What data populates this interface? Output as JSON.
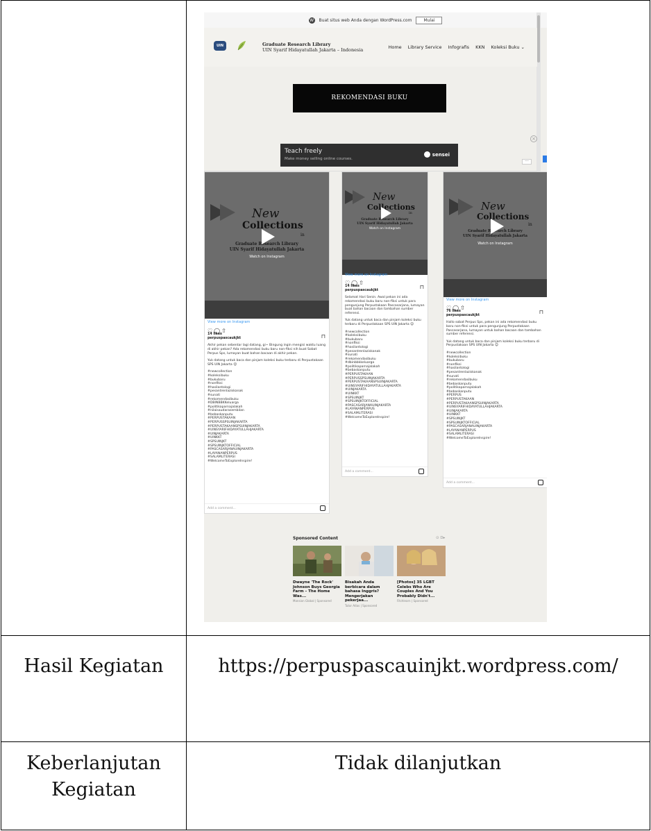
{
  "wp_bar": {
    "text": "Buat situs web Anda dengan WordPress.com",
    "button": "Mulai"
  },
  "site": {
    "logo_text": "UIN",
    "title_line1": "Graduate Research Library",
    "title_line2": "UIN Syarif Hidayatullah Jakarta – Indonesia",
    "nav": [
      "Home",
      "Library Service",
      "Infografis",
      "KKN",
      "Koleksi Buku"
    ],
    "nav_dropdown_glyph": "⌄",
    "heading": "REKOMENDASI BUKU"
  },
  "ad": {
    "title": "Teach freely",
    "subtitle": "Make money selling online courses.",
    "brand": "sensei",
    "close_glyph": "×",
    "menu_glyph": "···"
  },
  "posts": [
    {
      "image_text": {
        "new": "New",
        "collections": "Collections",
        "in": "in",
        "line1": "Graduate Research Library",
        "line2": "UIN Syarif Hidayatullah Jakarta",
        "watch": "Watch on Instagram"
      },
      "view_more": "View more on Instagram",
      "likes": "14 likes",
      "user": "perpuspascaukjkt",
      "caption": "Akhir pekan sebentar lagi datang, gi~ Bingung ingin mengisi waktu luang di akhir pekan? Ada rekomendasi buku baru non-fiksi nih buat Sobat Perpus Sps, lumayan buat bahan bacaan di akhir pekan.",
      "cta": "Yuk datang untuk baca dan pinjam koleksi buku terbaru di Perpustakaan SPS UIN Jakarta 😊",
      "tags": [
        "#newcollection",
        "#koleksibuku",
        "#bukubaru",
        "#nonfiksi",
        "#hasilantologi",
        "#pesantrenlaziskanak",
        "#sunati",
        "#rekomendasibuku",
        "#DBINBBKKeluarga",
        "#politikaparnajalakah",
        "#nilaisaudarasembilan",
        "#bebaskanputu",
        "#PERPUSTAKAAN",
        "#PERPUSSPSUINJAKARTA",
        "#PERPUSTAKAANSPSUINJAKARTA",
        "#UINSYARIFHIDAYATULLAHJAKARTA",
        "#UINJAKARTA",
        "#UINKKT",
        "#SPSUINJKT",
        "#SPSUINJKTOFFICIAL",
        "#PASCASARJANAUINJAKARTA",
        "#LAYANANPERPUS",
        "#SALAMLITERASI",
        "#WelcomeToExploreInspire!"
      ],
      "add_comment": "Add a comment..."
    },
    {
      "image_text": {
        "new": "New",
        "collections": "Collections",
        "in": "in",
        "line1": "Graduate Research Library",
        "line2": "UIN Syarif Hidayatullah Jakarta",
        "watch": "Watch on Instagram"
      },
      "view_more": "View more on Instagram",
      "likes": "14 likes",
      "user": "perpuspascaukjkt",
      "caption": "Selamat Hari Senin. Awal pekan ini ada rekomendasi buku baru non-fiksi untuk para pengunjung Perpustakaan Pascasarjana, lumayan buat bahan bacaan dan tambahan sumber referensi.",
      "cta": "Yuk datang untuk baca dan pinjam koleksi buku terbaru di Perpustakaan SPS UIN Jakarta 😊",
      "tags": [
        "#newcollection",
        "#koleksibuku",
        "#bukubaru",
        "#nonfiksi",
        "#hasilantologi",
        "#pesantrenlaziskanak",
        "#sunati",
        "#rekomendasibuku",
        "#dbinbbkkeluarga",
        "#politikaparnajalakah",
        "#bebaskanputu",
        "#PERPUSTAKAAN",
        "#PERPUSSPSUINJAKARTA",
        "#PERPUSTAKAANSPSUINJAKARTA",
        "#UINSYARIFHIDAYATULLAHJAKARTA",
        "#UINJAKARTA",
        "#UINKKT",
        "#SPSUINJKT",
        "#SPSUINJKTOFFICIAL",
        "#PASCASARJANAUINJAKARTA",
        "#LAYANANPERPUS",
        "#SALAMLITERASI",
        "#WelcomeToExploreInspire!"
      ],
      "add_comment": "Add a comment..."
    },
    {
      "image_text": {
        "new": "New",
        "collections": "Collections",
        "in": "in",
        "line1": "Graduate Research Library",
        "line2": "UIN Syarif Hidayatullah Jakarta",
        "watch": "Watch on Instagram"
      },
      "view_more": "View more on Instagram",
      "likes": "76 likes",
      "user": "perpuspascaukjkt",
      "caption": "Hallo sobat Perpus Sps, pekan ini ada rekomendasi buku baru non-fiksi untuk para pengunjung Perpustakaan Pascasarjana, lumayan untuk bahan bacaan dan tambahan sumber referensi.",
      "cta": "Yuk datang untuk baca dan pinjam koleksi buku terbaru di Perpustakaan SPS UIN Jakarta 😊",
      "tags": [
        "#newcollection",
        "#koleksibuku",
        "#bukubaru",
        "#nonfiksi",
        "#hasilantologi",
        "#pesantrenlaziskanak",
        "#sunati",
        "#rekomendasibuku",
        "#bebaskanputu",
        "#politikaparnajalakah",
        "#bebaskanputu",
        "#PERPUS",
        "#PERPUSTAKAAN",
        "#PERPUSTAKAANSPSUINJAKARTA",
        "#UINSYARIFHIDAYATULLAHJAKARTA",
        "#UINJAKARTA",
        "#UINKKT",
        "#SPSUINJKT",
        "#SPSUINJKTOFFICIAL",
        "#PASCASARJANAUINJAKARTA",
        "#LAYANANPERPUS",
        "#SALAMLITERASI",
        "#WelcomeToExploreInspire!"
      ],
      "add_comment": "Add a comment..."
    }
  ],
  "sponsored": {
    "title": "Sponsored Content",
    "logo": "⊙ D▸",
    "cards": [
      {
        "headline": "Dwayne 'The Rock' Johnson Buys Georgia Farm – The Home Was...",
        "source": "Mansion Global | Sponsored"
      },
      {
        "headline": "Bisakah Anda berbicara dalam bahasa Inggris? Mengerjakan pekerjaa...",
        "source": "Tutor Atlas | Sponsored"
      },
      {
        "headline": "[Photos] 35 LGBT Celebs Who Are Couples And You Probably Didn't...",
        "source": "Fitchlearn | Sponsored"
      }
    ]
  },
  "table": {
    "row2_label": "Hasil Kegiatan",
    "row2_value": "https://perpuspascauinjkt.wordpress.com/",
    "row3_label_line1": "Keberlanjutan",
    "row3_label_line2": "Kegiatan",
    "row3_value": "Tidak dilanjutkan"
  }
}
